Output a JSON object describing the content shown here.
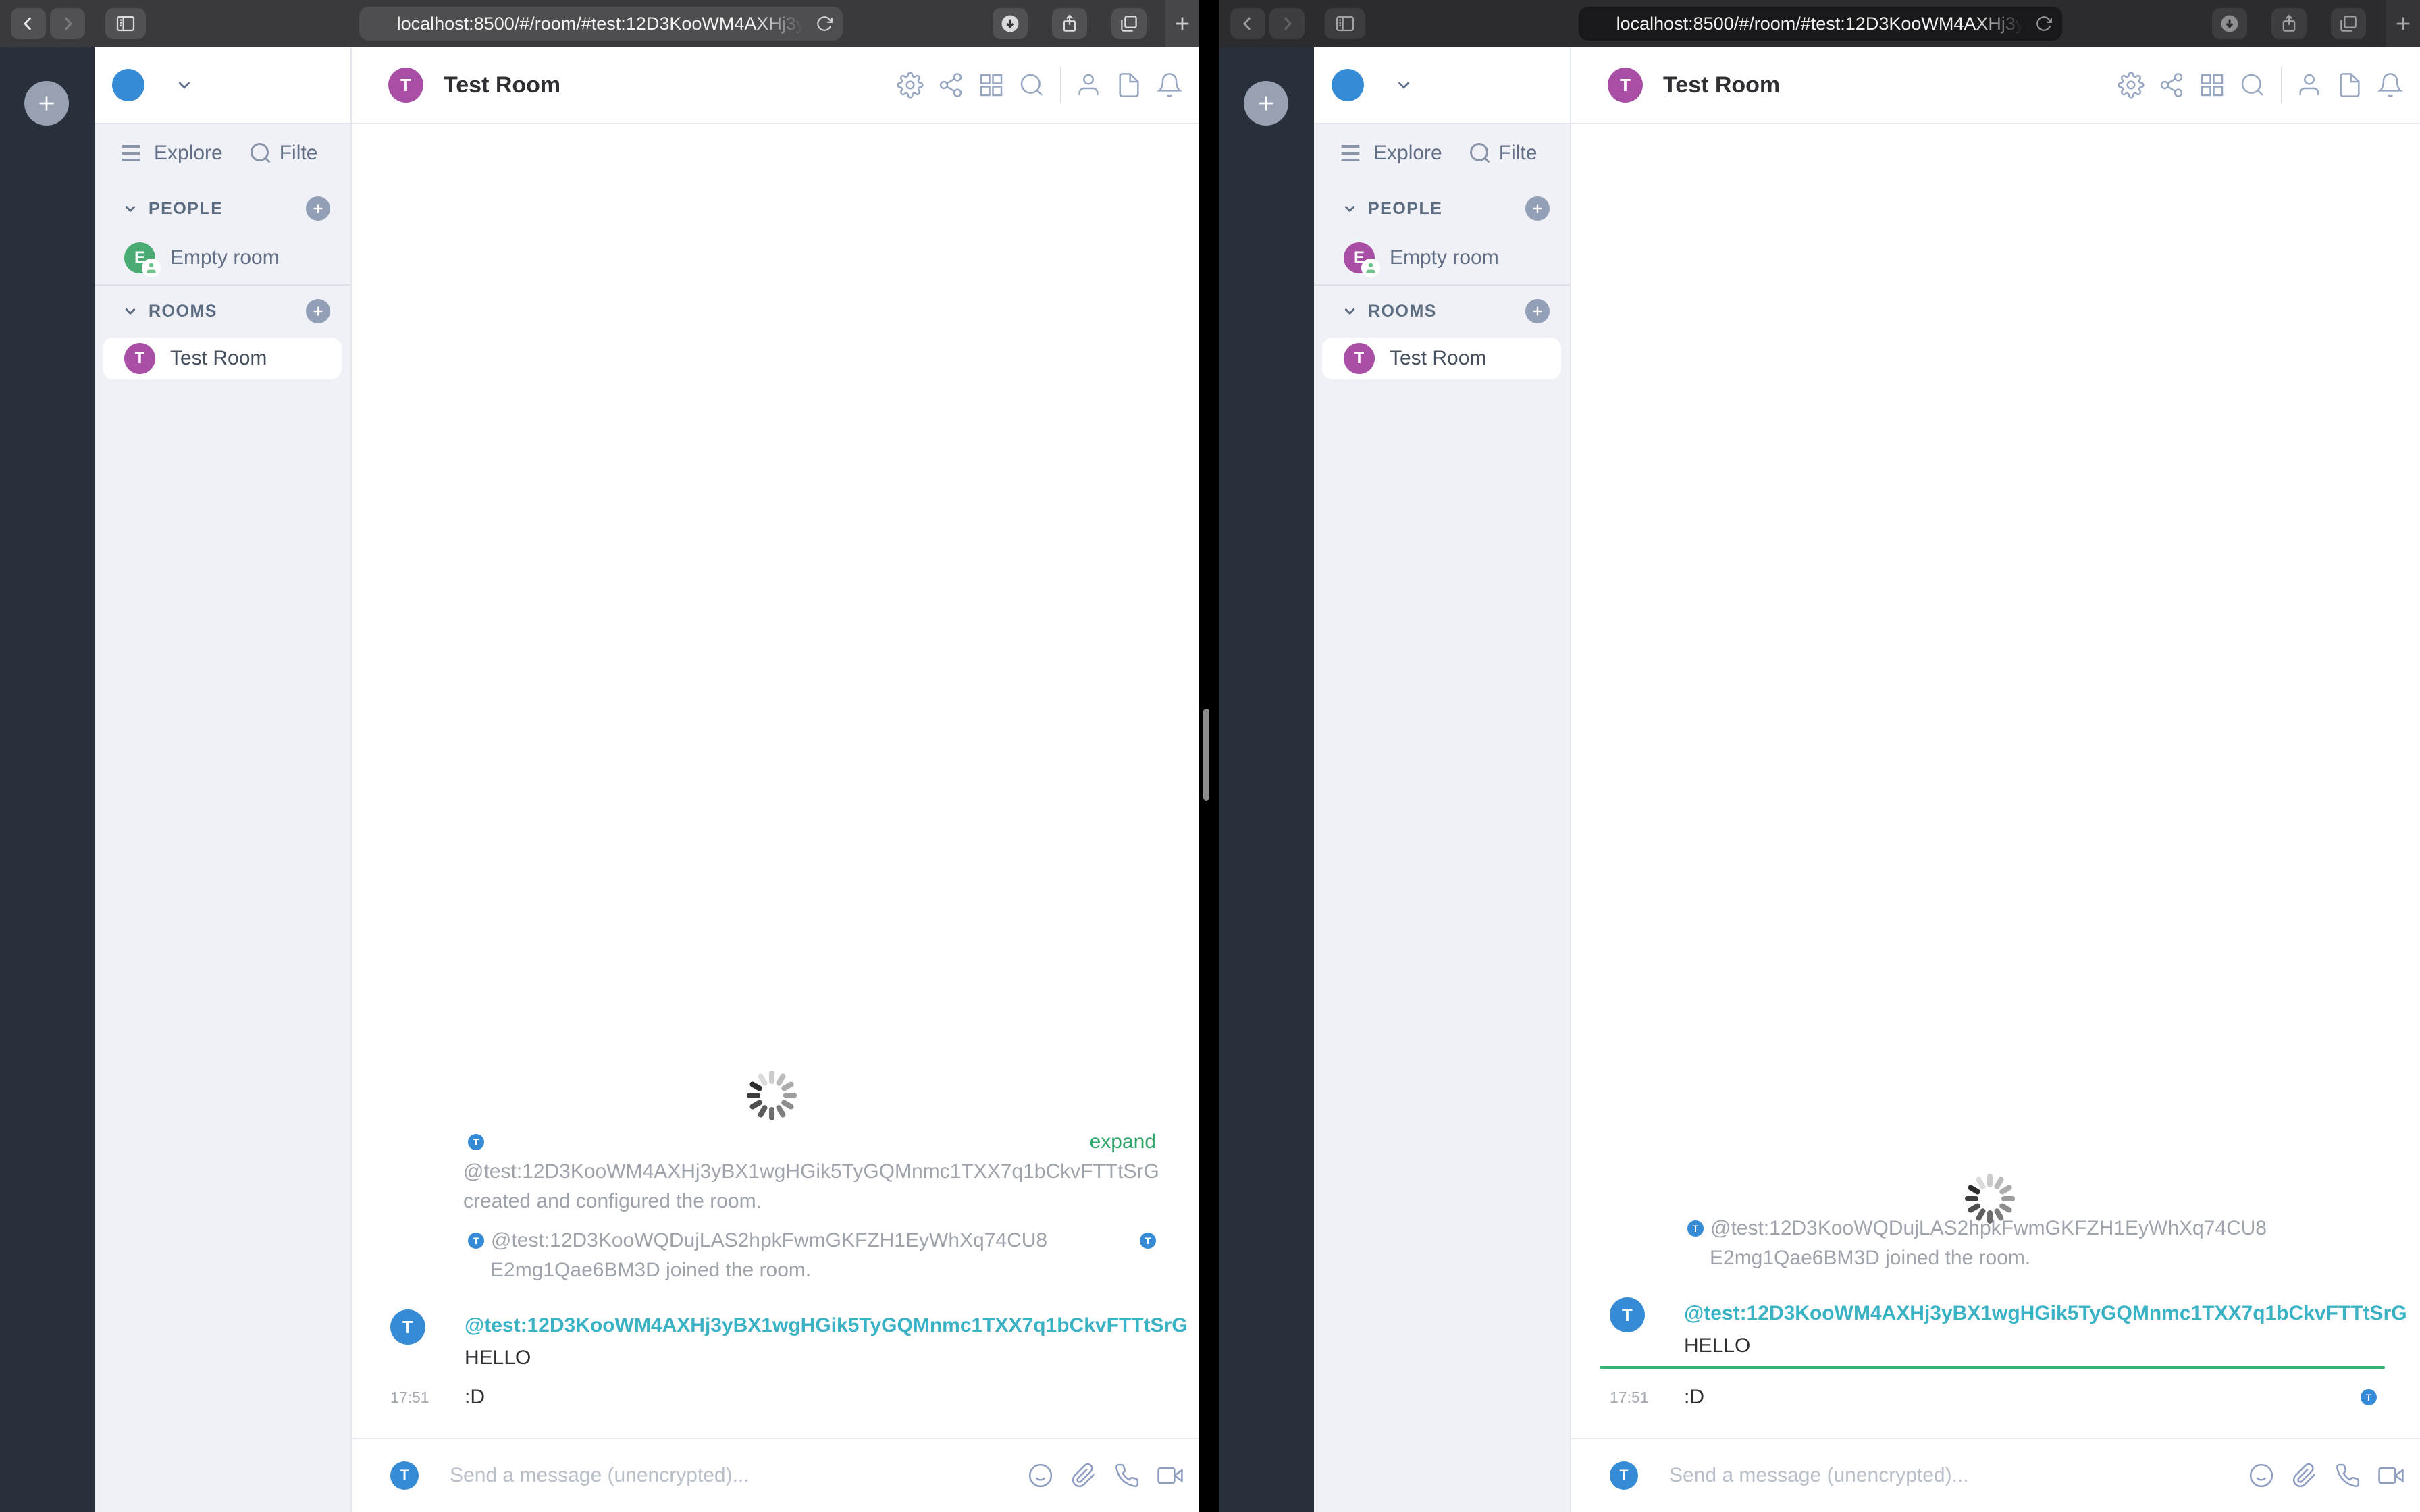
{
  "browser": {
    "url": "localhost:8500/#/room/#test:12D3KooWM4AXHj3y"
  },
  "sidebar": {
    "explore_label": "Explore",
    "filter_label": "Filte",
    "people_header": "PEOPLE",
    "rooms_header": "ROOMS",
    "empty_room": {
      "label": "Empty room",
      "initial": "E"
    },
    "test_room": {
      "label": "Test Room",
      "initial": "T"
    }
  },
  "room_header": {
    "title": "Test Room",
    "initial": "T"
  },
  "timeline": {
    "expand_link": "expand",
    "creator_id": "@test:12D3KooWM4AXHj3yBX1wgHGik5TyGQMnmc1TXX7q1bCkvFTTtSrG",
    "created_action": "created and configured the room.",
    "joiner_id": "@test:12D3KooWQDujLAS2hpkFwmGKFZH1EyWhXq74CU8",
    "joined_action": "E2mg1Qae6BM3D joined the room.",
    "sender_id": "@test:12D3KooWM4AXHj3yBX1wgHGik5TyGQMnmc1TXX7q1bCkvFTTtSrG",
    "message_hello": "HELLO",
    "message_smiley": ":D",
    "timestamp": "17:51",
    "avatar_initial": "T"
  },
  "composer": {
    "placeholder": "Send a message (unencrypted)...",
    "avatar_initial": "T"
  },
  "colors": {
    "avatar_blue": "#368bd6",
    "avatar_purple": "#a84fa5",
    "avatar_green": "#4aab74",
    "sender_teal": "#38b2c4",
    "expand_link_green": "#2fa76a",
    "unread_marker_green": "#36b374",
    "space_panel": "#2a303b",
    "sidebar_bg": "#eff1f6"
  }
}
